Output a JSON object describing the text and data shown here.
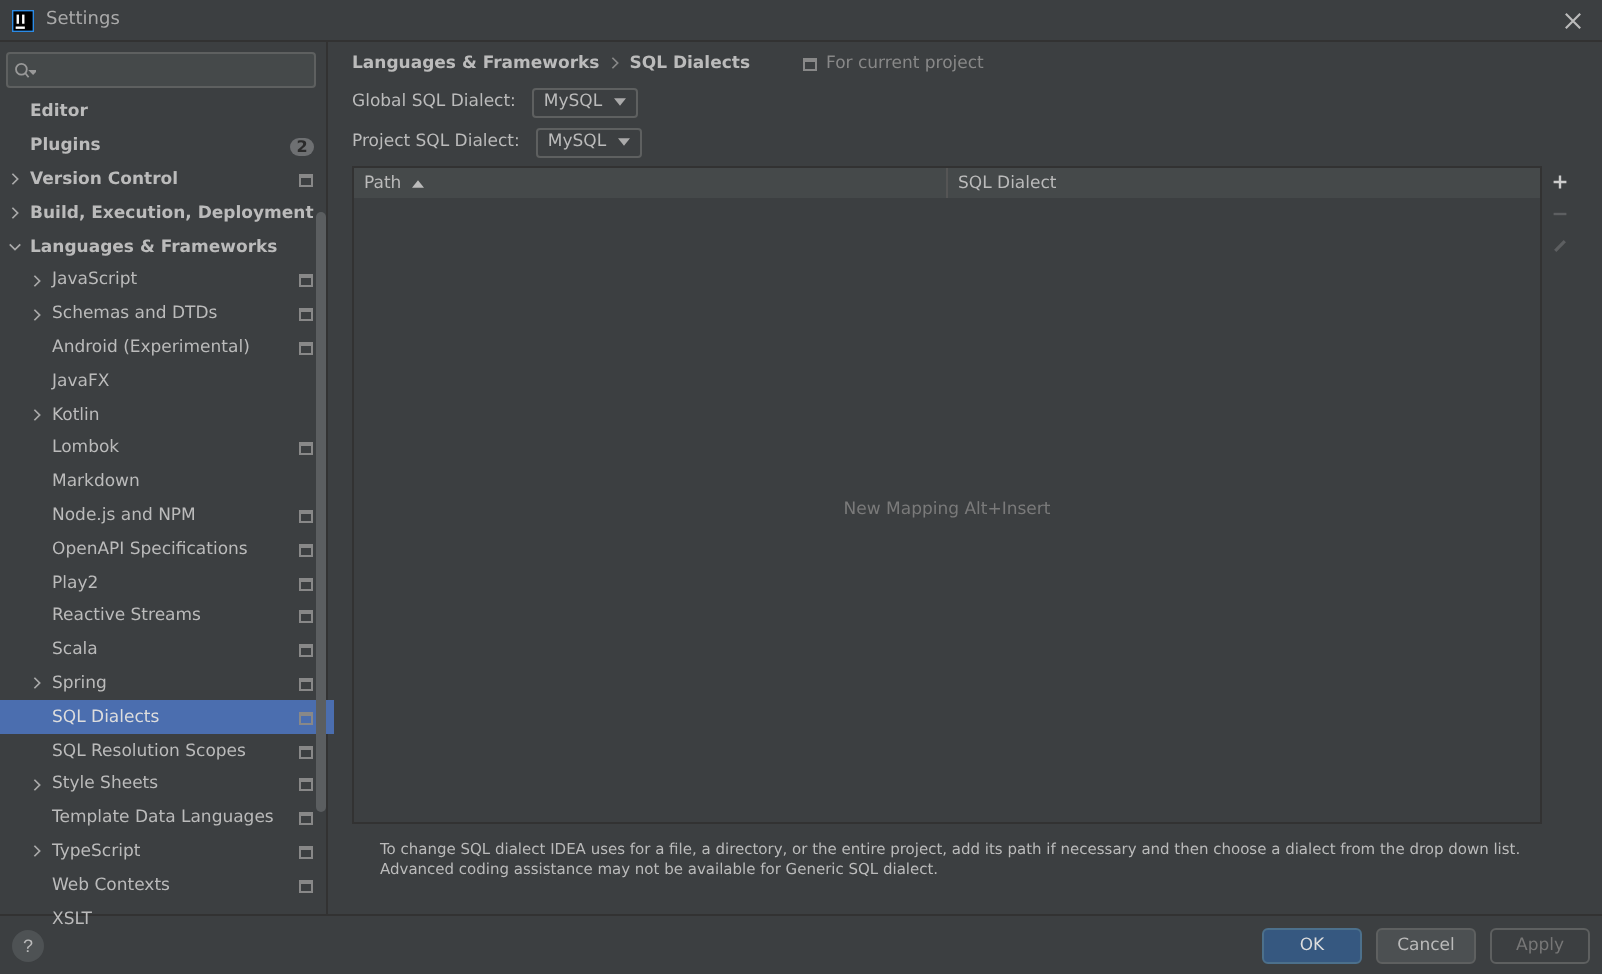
{
  "window": {
    "title": "Settings"
  },
  "sidebar": {
    "items": [
      {
        "label": "Editor",
        "selected": false
      },
      {
        "label": "Plugins",
        "selected": false,
        "badge": "2"
      },
      {
        "label": "Version Control",
        "selected": false,
        "expanded": false,
        "project_scope": true
      },
      {
        "label": "Build, Execution, Deployment",
        "selected": false,
        "expanded": false
      },
      {
        "label": "Languages & Frameworks",
        "selected": false,
        "expanded": true,
        "children": [
          {
            "label": "JavaScript",
            "selected": false,
            "expanded": false,
            "project_scope": true
          },
          {
            "label": "Schemas and DTDs",
            "selected": false,
            "expanded": false,
            "project_scope": true
          },
          {
            "label": "Android (Experimental)",
            "selected": false,
            "project_scope": true
          },
          {
            "label": "JavaFX",
            "selected": false
          },
          {
            "label": "Kotlin",
            "selected": false,
            "expanded": false
          },
          {
            "label": "Lombok",
            "selected": false,
            "project_scope": true
          },
          {
            "label": "Markdown",
            "selected": false
          },
          {
            "label": "Node.js and NPM",
            "selected": false,
            "project_scope": true
          },
          {
            "label": "OpenAPI Specifications",
            "selected": false,
            "project_scope": true
          },
          {
            "label": "Play2",
            "selected": false,
            "project_scope": true
          },
          {
            "label": "Reactive Streams",
            "selected": false,
            "project_scope": true
          },
          {
            "label": "Scala",
            "selected": false,
            "project_scope": true
          },
          {
            "label": "Spring",
            "selected": false,
            "expanded": false,
            "project_scope": true
          },
          {
            "label": "SQL Dialects",
            "selected": true,
            "project_scope": true
          },
          {
            "label": "SQL Resolution Scopes",
            "selected": false,
            "project_scope": true
          },
          {
            "label": "Style Sheets",
            "selected": false,
            "expanded": false,
            "project_scope": true
          },
          {
            "label": "Template Data Languages",
            "selected": false,
            "project_scope": true
          },
          {
            "label": "TypeScript",
            "selected": false,
            "expanded": false,
            "project_scope": true
          },
          {
            "label": "Web Contexts",
            "selected": false,
            "project_scope": true
          },
          {
            "label": "XSLT",
            "selected": false
          }
        ]
      }
    ]
  },
  "breadcrumb": [
    "Languages & Frameworks",
    "SQL Dialects"
  ],
  "scope_note": "For current project",
  "settings": [
    {
      "label": "Global SQL Dialect:",
      "value": "MySQL"
    },
    {
      "label": "Project SQL Dialect:",
      "value": "MySQL"
    }
  ],
  "table": {
    "columns": [
      {
        "label": "Path",
        "sorted": true
      },
      {
        "label": "SQL Dialect"
      }
    ],
    "empty_text": "New Mapping Alt+Insert"
  },
  "toolbar": [
    {
      "kind": "add",
      "disabled": false
    },
    {
      "kind": "remove",
      "disabled": true
    },
    {
      "kind": "edit",
      "disabled": true
    }
  ],
  "description": "To change SQL dialect IDEA uses for a file, a directory, or the entire project, add its path if necessary and then choose a dialect from the drop down list. Advanced coding assistance may not be available for Generic SQL dialect.",
  "help": "?",
  "buttons": [
    {
      "label": "OK",
      "kind": "primary"
    },
    {
      "label": "Cancel",
      "kind": "normal"
    },
    {
      "label": "Apply",
      "kind": "disabled"
    }
  ]
}
